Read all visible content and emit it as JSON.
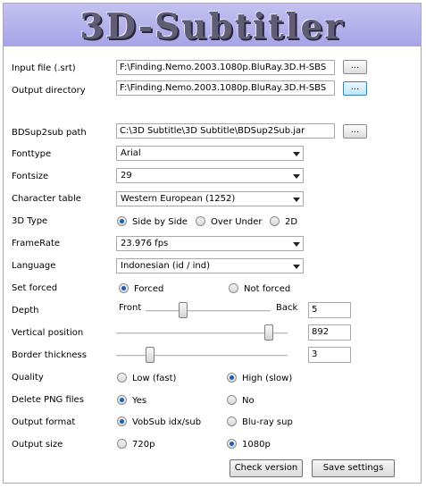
{
  "app": {
    "title": "3D-Subtitler"
  },
  "input_file": {
    "label": "Input file (.srt)",
    "value": "F:\\Finding.Nemo.2003.1080p.BluRay.3D.H-SBS",
    "browse_label": "..."
  },
  "output_directory": {
    "label": "Output directory",
    "value": "F:\\Finding.Nemo.2003.1080p.BluRay.3D.H-SBS",
    "browse_label": "..."
  },
  "bdsup2sub": {
    "label": "BDSup2sub path",
    "value": "C:\\3D Subtitle\\3D Subtitle\\BDSup2Sub.jar",
    "browse_label": "..."
  },
  "fonttype": {
    "label": "Fonttype",
    "selected": "Arial"
  },
  "fontsize": {
    "label": "Fontsize",
    "selected": "29"
  },
  "character_table": {
    "label": "Character table",
    "selected": "Western European (1252)"
  },
  "type_3d": {
    "label": "3D Type",
    "options": [
      "Side by Side",
      "Over Under",
      "2D"
    ],
    "selected": "Side by Side"
  },
  "framerate": {
    "label": "FrameRate",
    "selected": "23.976 fps"
  },
  "language": {
    "label": "Language",
    "selected": "Indonesian (id / ind)"
  },
  "set_forced": {
    "label": "Set forced",
    "options": [
      "Forced",
      "Not forced"
    ],
    "selected": "Forced"
  },
  "depth": {
    "label": "Depth",
    "left_label": "Front",
    "right_label": "Back",
    "value": "5",
    "slider_level": 0.3
  },
  "vertical_position": {
    "label": "Vertical position",
    "value": "892",
    "slider_level": 0.89
  },
  "border_thickness": {
    "label": "Border thickness",
    "value": "3",
    "slider_level": 0.2
  },
  "quality": {
    "label": "Quality",
    "options": [
      "Low (fast)",
      "High (slow)"
    ],
    "selected": "High (slow)"
  },
  "delete_png": {
    "label": "Delete PNG files",
    "options": [
      "Yes",
      "No"
    ],
    "selected": "Yes"
  },
  "output_format": {
    "label": "Output format",
    "options": [
      "VobSub idx/sub",
      "Blu-ray sup"
    ],
    "selected": "VobSub idx/sub"
  },
  "output_size": {
    "label": "Output size",
    "options": [
      "720p",
      "1080p"
    ],
    "selected": "1080p"
  },
  "buttons": {
    "check_version": "Check version",
    "save_settings": "Save settings"
  },
  "colors": {
    "banner_top": "#c4c1f0",
    "banner_bottom": "#a7a3e8",
    "radio_dot": "#1c5db8"
  }
}
